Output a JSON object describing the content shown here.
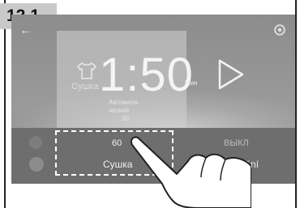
{
  "step_number": "12.1",
  "screen": {
    "back_icon": "back-arrow-icon",
    "settings_icon": "gear-icon",
    "program_label": "Сушка",
    "time_value": "1:50",
    "time_unit": "Мин",
    "options": [
      "Автомати-",
      "ческий",
      "30"
    ],
    "play_icon": "play-icon"
  },
  "bottom_bar": {
    "dry": {
      "value": "60",
      "label": "Сушка"
    },
    "delay": {
      "value": "ВЫКЛ",
      "label": "Zpoždění"
    }
  },
  "colors": {
    "screen_bg": "#8c8c8c",
    "bottom_bar_bg": "#6e6e6e",
    "highlight_border": "#ffffff",
    "hand_fill": "#ffffff",
    "hand_stroke": "#222222"
  }
}
